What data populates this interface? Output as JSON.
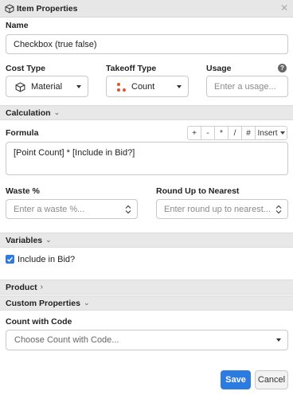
{
  "window": {
    "title": "Item Properties",
    "close_glyph": "✕"
  },
  "name": {
    "label": "Name",
    "value": "Checkbox (true false)"
  },
  "cost_type": {
    "label": "Cost Type",
    "value": "Material",
    "icon": "cube-icon"
  },
  "takeoff_type": {
    "label": "Takeoff Type",
    "value": "Count",
    "icon": "count-dots-icon",
    "dot_color": "#e0542b"
  },
  "usage": {
    "label": "Usage",
    "placeholder": "Enter a usage...",
    "help_glyph": "?"
  },
  "calculation": {
    "section_label": "Calculation",
    "formula_label": "Formula",
    "formula_value": "[Point Count] * [Include in Bid?]",
    "toolbar": [
      "+",
      "-",
      "*",
      "/",
      "#"
    ],
    "insert_label": "Insert"
  },
  "waste": {
    "label": "Waste %",
    "placeholder": "Enter a waste %..."
  },
  "round_up": {
    "label": "Round Up to Nearest",
    "placeholder": "Enter round up to nearest..."
  },
  "variables": {
    "section_label": "Variables",
    "include_in_bid": {
      "label": "Include in Bid?",
      "checked": true
    }
  },
  "product": {
    "section_label": "Product"
  },
  "custom_properties": {
    "section_label": "Custom Properties"
  },
  "count_with_code": {
    "label": "Count with Code",
    "placeholder": "Choose Count with Code..."
  },
  "actions": {
    "save_label": "Save",
    "cancel_label": "Cancel"
  },
  "colors": {
    "accent": "#2b7be0",
    "section_bg": "#e8e8e8",
    "border": "#c9c9c9"
  }
}
